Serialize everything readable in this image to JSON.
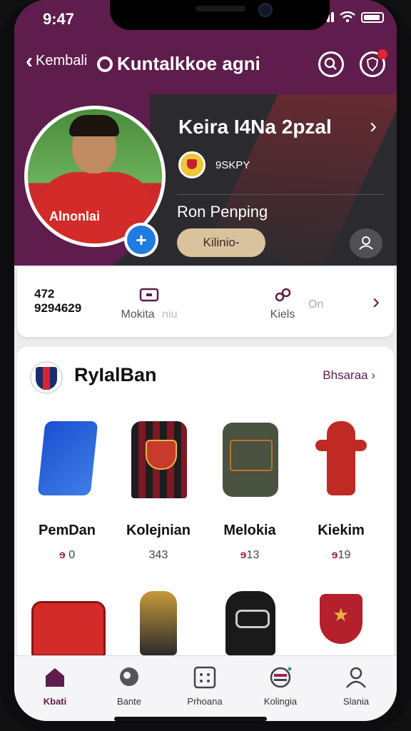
{
  "status_bar": {
    "time": "9:47"
  },
  "nav": {
    "back_label": "Kembali",
    "title": "Kuntalkkoe agni"
  },
  "profile": {
    "jersey_text": "Alnonlai",
    "name": "Keira I4Na 2pzal",
    "club_code": "9SKPY",
    "role": "Ron Penping",
    "follow_label": "Kilinio-",
    "add_icon": "plus-icon"
  },
  "stats": {
    "count_top": "472",
    "count_bottom": "9294629",
    "item1_label": "Mokita",
    "item1_suffix": "niu",
    "item2_label": "Kiels",
    "item2_extra": "On"
  },
  "shop": {
    "title": "RyIalBan",
    "more_label": "Bhsaraa",
    "products": [
      {
        "name": "PemDan",
        "price": "0",
        "icon": "towel-icon"
      },
      {
        "name": "Kolejnian",
        "price": "343",
        "icon": "jersey-icon"
      },
      {
        "name": "Melokia",
        "price": "13",
        "icon": "backpack-icon"
      },
      {
        "name": "Kiekim",
        "price": "19",
        "icon": "figure-icon"
      }
    ],
    "products_row2": [
      {
        "icon": "bag-icon"
      },
      {
        "icon": "gold-figure-icon"
      },
      {
        "icon": "pack-icon"
      },
      {
        "icon": "trophy-icon"
      }
    ]
  },
  "tabs": [
    {
      "label": "Kbati",
      "icon": "home-icon",
      "active": true
    },
    {
      "label": "Bante",
      "icon": "chat-icon"
    },
    {
      "label": "Prhoana",
      "icon": "grid-icon"
    },
    {
      "label": "Kolingia",
      "icon": "cart-icon"
    },
    {
      "label": "Slania",
      "icon": "profile-icon"
    }
  ],
  "colors": {
    "brand": "#5e1d4c",
    "accent": "#a41f56",
    "follow_bg": "#d8c39d"
  }
}
